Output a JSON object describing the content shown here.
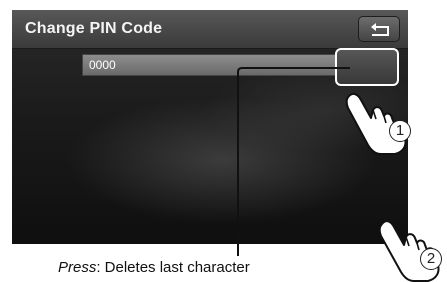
{
  "screen": {
    "title": "Change PIN Code",
    "back_icon": "return-arrow-icon",
    "pin_value": "0000",
    "delete_button_icon": "none"
  },
  "callout": {
    "press_label": "Press",
    "press_description": ": Deletes last character"
  },
  "steps": {
    "step1": "1",
    "step2": "2"
  }
}
